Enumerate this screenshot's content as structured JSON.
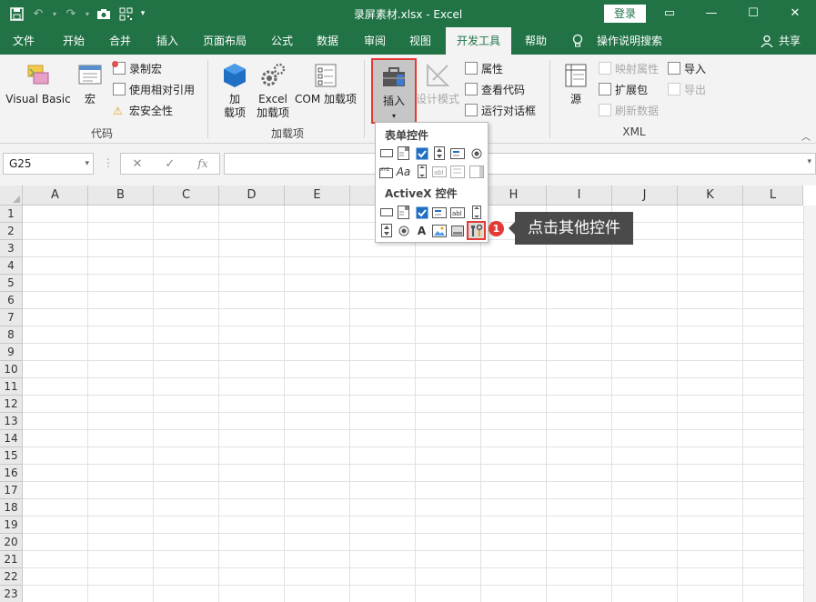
{
  "window": {
    "title": "录屏素材.xlsx  -  Excel",
    "login": "登录"
  },
  "qat": {
    "save_icon": "save-icon",
    "undo_icon": "undo-icon",
    "redo_icon": "redo-icon",
    "camera_icon": "camera-icon",
    "grid_icon": "qr-icon"
  },
  "tabs": [
    "文件",
    "开始",
    "合并",
    "插入",
    "页面布局",
    "公式",
    "数据",
    "审阅",
    "视图",
    "开发工具",
    "帮助",
    "操作说明搜索",
    "共享"
  ],
  "ribbon": {
    "code": {
      "label": "代码",
      "visual_basic": "Visual Basic",
      "macro": "宏",
      "record_macro": "录制宏",
      "relative_ref": "使用相对引用",
      "macro_security": "宏安全性"
    },
    "addins": {
      "label": "加载项",
      "addins_line1": "加",
      "addins_line2": "载项",
      "excel_addins_line1": "Excel",
      "excel_addins_line2": "加载项",
      "com_addins": "COM 加载项"
    },
    "controls": {
      "insert": "插入",
      "design_mode": "设计模式",
      "properties": "属性",
      "view_code": "查看代码",
      "run_dialog": "运行对话框"
    },
    "xml": {
      "label": "XML",
      "source": "源",
      "map_props": "映射属性",
      "expansion": "扩展包",
      "refresh": "刷新数据",
      "import": "导入",
      "export": "导出"
    }
  },
  "formula_bar": {
    "name_box": "G25",
    "fx": "fx"
  },
  "dropdown": {
    "form_controls": "表单控件",
    "activex_controls": "ActiveX 控件"
  },
  "columns": [
    "A",
    "B",
    "C",
    "D",
    "E",
    "F",
    "G",
    "H",
    "I",
    "J",
    "K",
    "L"
  ],
  "rows": [
    "1",
    "2",
    "3",
    "4",
    "5",
    "6",
    "7",
    "8",
    "9",
    "10",
    "11",
    "12",
    "13",
    "14",
    "15",
    "16",
    "17",
    "18",
    "19",
    "20",
    "21",
    "22",
    "23"
  ],
  "annotation": {
    "step": "1",
    "text": "点击其他控件"
  },
  "colors": {
    "excel_green": "#217346",
    "highlight_red": "#e53935",
    "callout_bg": "#4a4a4a"
  }
}
